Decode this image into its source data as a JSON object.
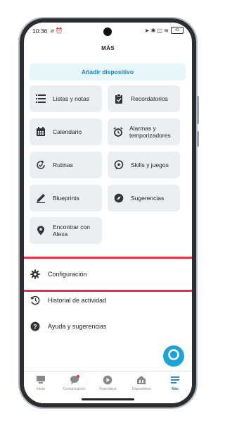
{
  "status_bar": {
    "time": "10:36",
    "left_icons": "⌀ ⏰",
    "right_icons": "➤ ✱ ◫ ≋",
    "battery": "42"
  },
  "header": {
    "title": "MÁS"
  },
  "add_device": {
    "label": "Añadir dispositivo"
  },
  "tiles": [
    {
      "label": "Listas y notas",
      "icon": "list-icon"
    },
    {
      "label": "Recordatorios",
      "icon": "clipboard-check-icon"
    },
    {
      "label": "Calendario",
      "icon": "calendar-icon"
    },
    {
      "label": "Alarmas y temporizadores",
      "icon": "alarm-clock-icon"
    },
    {
      "label": "Rutinas",
      "icon": "routine-check-icon"
    },
    {
      "label": "Skills y juegos",
      "icon": "chat-bubble-icon"
    },
    {
      "label": "Blueprints",
      "icon": "pencil-icon"
    },
    {
      "label": "Sugerencias",
      "icon": "compass-icon"
    },
    {
      "label": "Encontrar con Alexa",
      "icon": "location-pin-icon"
    }
  ],
  "menu": {
    "settings": "Configuración",
    "history": "Historial de actividad",
    "help": "Ayuda y sugerencias"
  },
  "tabs": [
    {
      "label": "Inicio",
      "icon": "home-icon"
    },
    {
      "label": "Comunicación",
      "icon": "chat-icon"
    },
    {
      "label": "Reproducir",
      "icon": "play-icon"
    },
    {
      "label": "Dispositivos",
      "icon": "devices-icon"
    },
    {
      "label": "Más",
      "icon": "menu-icon",
      "active": true
    }
  ],
  "colors": {
    "accent": "#1c7fae",
    "highlight": "#e0344c",
    "fab": "#1ea3d8",
    "tile_bg": "#eceff1",
    "banner_bg": "#e6f6fb"
  }
}
